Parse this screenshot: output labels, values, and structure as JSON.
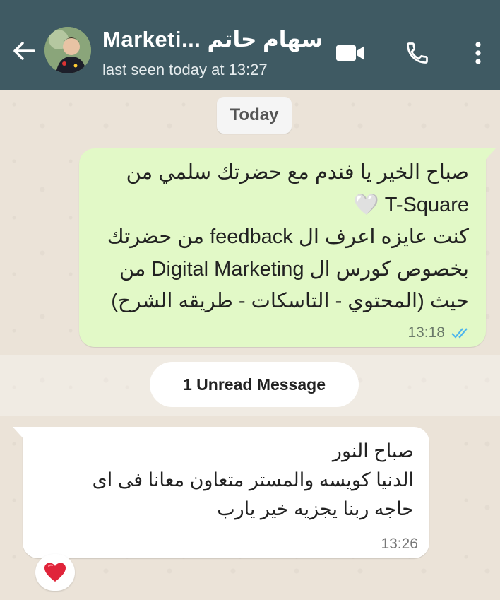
{
  "header": {
    "title": "Marketi... سهام حاتم",
    "subtitle": "last seen today at 13:27",
    "icons": [
      "back-arrow-icon",
      "video-call-icon",
      "phone-icon",
      "more-vert-icon"
    ]
  },
  "chat": {
    "date_chip": "Today",
    "outgoing": {
      "lines": [
        "صباح الخير يا فندم مع حضرتك سلمي من",
        "T-Square 🤍",
        "كنت عايزه اعرف ال feedback  من حضرتك",
        "بخصوص كورس ال Digital Marketing  من",
        "حيث (المحتوي - التاسكات - طريقه الشرح)"
      ],
      "time": "13:18",
      "status": "read"
    },
    "unread_label": "1 Unread Message",
    "incoming": {
      "lines": [
        "صباح النور",
        "الدنيا كويسه والمستر متعاون معانا فى اى",
        "حاجه ربنا يجزيه خير يارب"
      ],
      "time": "13:26",
      "reaction": "❤️"
    }
  },
  "colors": {
    "header_bg": "#3f5a63",
    "outgoing_bg": "#e2f9c7",
    "incoming_bg": "#ffffff",
    "read_ticks": "#4fb6ec"
  }
}
